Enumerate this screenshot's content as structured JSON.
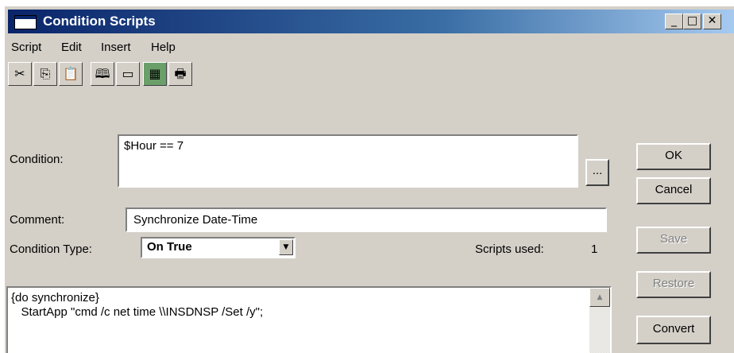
{
  "window": {
    "title": "Condition Scripts",
    "controls": {
      "minimize": "_",
      "maximize": "□",
      "close": "✕"
    }
  },
  "menu": [
    "Script",
    "Edit",
    "Insert",
    "Help"
  ],
  "toolbar": {
    "buttons": [
      "cut-icon",
      "copy-icon",
      "paste-icon",
      "find-icon",
      "window-icon",
      "convert-icon",
      "print-icon"
    ],
    "glyphs": [
      "✂",
      "⎘",
      "📋",
      "🕮",
      "▭",
      "▦",
      "🖶"
    ]
  },
  "condition": {
    "label": "Condition:",
    "value": "$Hour == 7",
    "browse_label": "..."
  },
  "comment": {
    "label": "Comment:",
    "value": "Synchronize Date-Time"
  },
  "condition_type": {
    "label": "Condition Type:",
    "value": "On True"
  },
  "scripts_used": {
    "label": "Scripts used:",
    "value": "1"
  },
  "script": {
    "lines": [
      "{do synchronize}",
      "   StartApp \"cmd /c net time \\\\INSDNSP /Set /y\";"
    ]
  },
  "buttons": {
    "ok": "OK",
    "cancel": "Cancel",
    "save": "Save",
    "restore": "Restore",
    "convert": "Convert"
  }
}
